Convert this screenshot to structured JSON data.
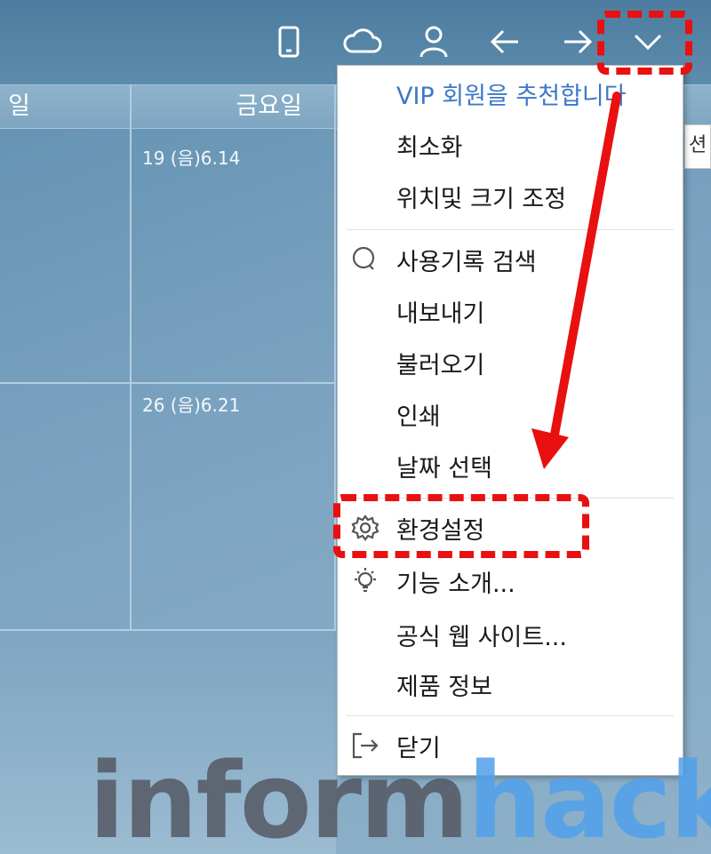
{
  "toolbar": {
    "icons": [
      "mobile-icon",
      "cloud-icon",
      "user-icon",
      "back-arrow-icon",
      "forward-arrow-icon",
      "chevron-down-icon"
    ]
  },
  "calendar": {
    "header": {
      "day_left": "일",
      "day_friday": "금요일"
    },
    "cells": {
      "fri_week1": "19  (음)6.14",
      "fri_week2": "26  (음)6.21"
    },
    "right_edge_text": "션"
  },
  "menu": {
    "items": [
      {
        "label": "VIP 회원을 추천합니다",
        "icon": ""
      },
      {
        "label": "최소화",
        "icon": ""
      },
      {
        "label": "위치및 크기 조정",
        "icon": ""
      },
      {
        "label": "사용기록 검색",
        "icon": "search-icon"
      },
      {
        "label": "내보내기",
        "icon": ""
      },
      {
        "label": "불러오기",
        "icon": ""
      },
      {
        "label": "인쇄",
        "icon": ""
      },
      {
        "label": "날짜 선택",
        "icon": ""
      },
      {
        "label": "환경설정",
        "icon": "gear-icon"
      },
      {
        "label": "기능 소개...",
        "icon": "lightbulb-icon"
      },
      {
        "label": "공식 웹 사이트...",
        "icon": ""
      },
      {
        "label": "제품 정보",
        "icon": ""
      },
      {
        "label": "닫기",
        "icon": "exit-icon"
      }
    ]
  },
  "watermark": {
    "part1": "inform",
    "part2": "hack"
  },
  "colors": {
    "accent_link": "#3b78c6",
    "annotation_red": "#e81010"
  }
}
